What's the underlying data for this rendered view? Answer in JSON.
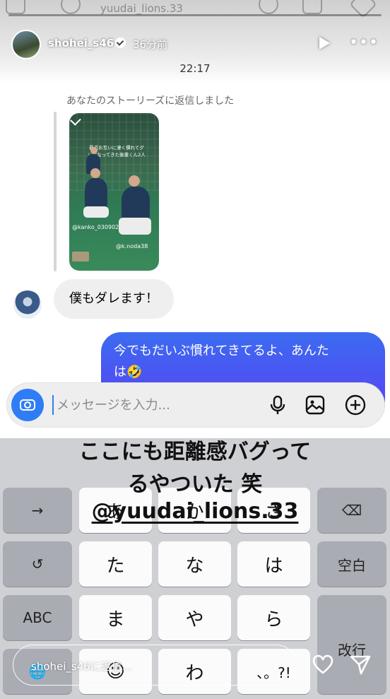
{
  "story": {
    "username": "shohei_s46",
    "time_ago": "36分前",
    "top_ghost_username": "yuudai_lions.33"
  },
  "chat": {
    "timestamp": "22:17",
    "reply_caption": "あなたのストーリーズに返信しました",
    "story_thumbnail": {
      "caption": "最近お互いに凄く慣れてグレになってきた後輩くん2人",
      "tag1": "@kanko_030902",
      "tag2": "@k.noda38"
    },
    "incoming_message": "僕もダレます！",
    "outgoing_message_line1": "今でもだいぶ慣れてきてるよ、あんた",
    "outgoing_message_line2": "は🤣"
  },
  "composer": {
    "placeholder": "メッセージを入力..."
  },
  "overlay": {
    "line1": "ここにも距離感バグって",
    "line2": "るやついた 笑",
    "mention": "@yuudai_lions.33"
  },
  "keyboard": {
    "row1": [
      "→",
      "あ",
      "か",
      "さ",
      "⌫"
    ],
    "row2": [
      "↺",
      "た",
      "な",
      "は",
      "空白"
    ],
    "row3": [
      "ABC",
      "ま",
      "や",
      "ら"
    ],
    "row4": [
      "🌐",
      "☺",
      "わ",
      "、。?!",
      "改行"
    ]
  },
  "reply_bar": {
    "placeholder": "shohei_s46に返信..."
  },
  "colors": {
    "accent_blue": "#2f7df6",
    "bubble_gradient_start": "#3b6cf0",
    "bubble_gradient_end": "#5d3bf5"
  }
}
